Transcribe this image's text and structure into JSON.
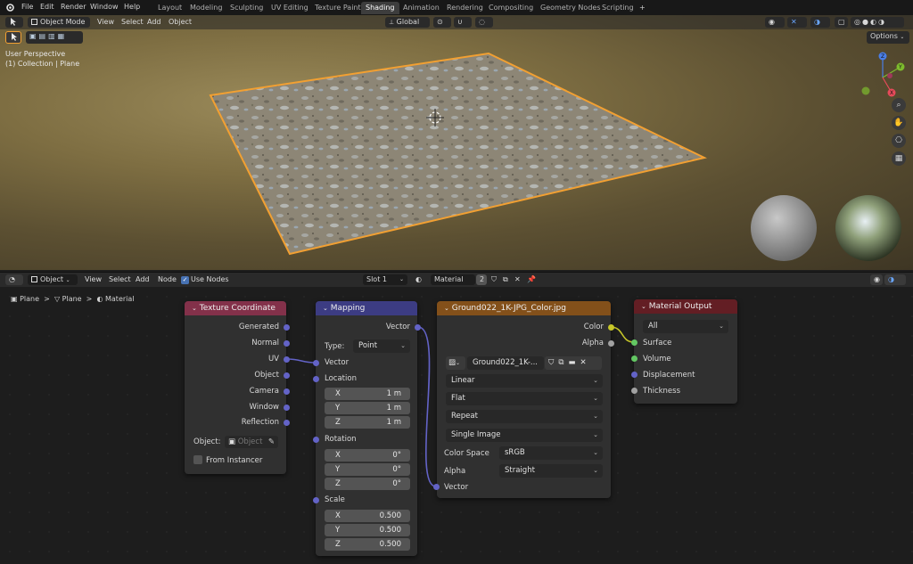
{
  "menu": {
    "items": [
      "File",
      "Edit",
      "Render",
      "Window",
      "Help"
    ]
  },
  "workspaces": {
    "tabs": [
      "Layout",
      "Modeling",
      "Sculpting",
      "UV Editing",
      "Texture Paint",
      "Shading",
      "Animation",
      "Rendering",
      "Compositing",
      "Geometry Nodes",
      "Scripting"
    ],
    "active": "Shading",
    "add": "+"
  },
  "viewport": {
    "mode": "Object Mode",
    "menus": [
      "View",
      "Select",
      "Add",
      "Object"
    ],
    "transform_orientation": "Global",
    "options": "Options",
    "info_line1": "User Perspective",
    "info_line2": "(1) Collection | Plane",
    "gizmo": {
      "x": "X",
      "y": "Y",
      "z": "Z"
    }
  },
  "node_editor": {
    "editor_type": "Object",
    "menus": [
      "View",
      "Select",
      "Add",
      "Node"
    ],
    "use_nodes": "Use Nodes",
    "slot": "Slot 1",
    "material": "Material",
    "users": "2",
    "breadcrumb": [
      "Plane",
      "Plane",
      "Material"
    ]
  },
  "nodes": {
    "tex_coord": {
      "title": "Texture Coordinate",
      "outputs": [
        "Generated",
        "Normal",
        "UV",
        "Object",
        "Camera",
        "Window",
        "Reflection"
      ],
      "object_label": "Object:",
      "object_placeholder": "Object",
      "from_instancer": "From Instancer"
    },
    "mapping": {
      "title": "Mapping",
      "output": "Vector",
      "type_label": "Type:",
      "type_value": "Point",
      "vector": "Vector",
      "location": "Location",
      "loc": [
        [
          "X",
          "1 m"
        ],
        [
          "Y",
          "1 m"
        ],
        [
          "Z",
          "1 m"
        ]
      ],
      "rotation": "Rotation",
      "rot": [
        [
          "X",
          "0°"
        ],
        [
          "Y",
          "0°"
        ],
        [
          "Z",
          "0°"
        ]
      ],
      "scale": "Scale",
      "scl": [
        [
          "X",
          "0.500"
        ],
        [
          "Y",
          "0.500"
        ],
        [
          "Z",
          "0.500"
        ]
      ]
    },
    "image": {
      "title": "Ground022_1K-JPG_Color.jpg",
      "out_color": "Color",
      "out_alpha": "Alpha",
      "image_name": "Ground022_1K-...",
      "interpolation": "Linear",
      "projection": "Flat",
      "extension": "Repeat",
      "source": "Single Image",
      "colorspace_label": "Color Space",
      "colorspace": "sRGB",
      "alpha_label": "Alpha",
      "alpha": "Straight",
      "vector": "Vector"
    },
    "output": {
      "title": "Material Output",
      "target": "All",
      "inputs": [
        "Surface",
        "Volume",
        "Displacement",
        "Thickness"
      ]
    }
  },
  "colors": {
    "tex_head": "#83314a",
    "map_head": "#3c3c83",
    "img_head": "#83501a",
    "out_head": "#631e24",
    "sock_vector": "#6363c7",
    "sock_color": "#c7c729",
    "sock_shader": "#63c763",
    "sock_float": "#a1a1a1",
    "selection": "#f2a032"
  }
}
